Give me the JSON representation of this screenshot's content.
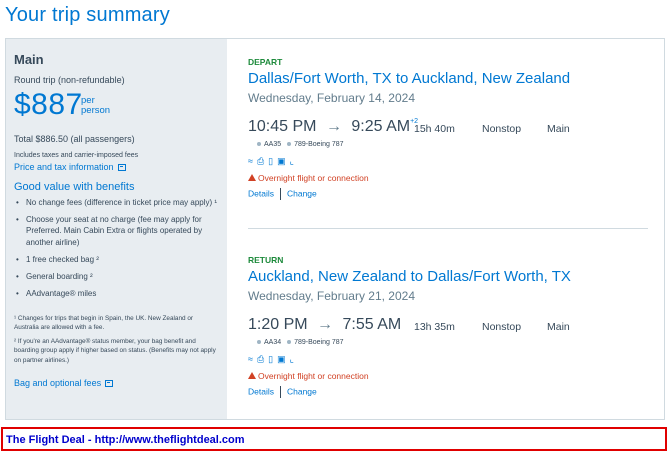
{
  "page_title": "Your trip summary",
  "fare": {
    "name": "Main",
    "type": "Round trip (non-refundable)",
    "price": "$887",
    "per_line1": "per",
    "per_line2": "person",
    "total": "Total $886.50 (all passengers)",
    "includes": "Includes taxes and carrier-imposed fees",
    "tax_link": "Price and tax information"
  },
  "benefits": {
    "heading": "Good value with benefits",
    "items": [
      "No change fees (difference in ticket price may apply) ¹",
      "Choose your seat at no charge (fee may apply for Preferred. Main Cabin Extra or flights operated by another airline)",
      "1 free checked bag ²",
      "General boarding ²",
      "AAdvantage® miles"
    ],
    "footnote1": "¹ Changes for trips that begin in Spain, the UK. New Zealand or Australia are allowed with a fee.",
    "footnote2": "² If you're an AAdvantage® status member, your bag benefit and boarding group apply if higher based on status. (Benefits may not apply on partner airlines.)",
    "bag_link": "Bag and optional fees"
  },
  "segments": [
    {
      "label": "DEPART",
      "route": "Dallas/Fort Worth, TX to Auckland, New Zealand",
      "date": "Wednesday, February 14, 2024",
      "depart_time": "10:45 PM",
      "arrow": "→",
      "arrive_time": "9:25 AM",
      "day_offset": "+2",
      "duration": "15h 40m",
      "stops": "Nonstop",
      "cabin": "Main",
      "flight": "AA35",
      "aircraft": "789-Boeing 787",
      "overnight": "Overnight flight or connection",
      "details": "Details",
      "change": "Change"
    },
    {
      "label": "RETURN",
      "route": "Auckland, New Zealand to Dallas/Fort Worth, TX",
      "date": "Wednesday, February 21, 2024",
      "depart_time": "1:20 PM",
      "arrow": "→",
      "arrive_time": "7:55 AM",
      "day_offset": "",
      "duration": "13h 35m",
      "stops": "Nonstop",
      "cabin": "Main",
      "flight": "AA34",
      "aircraft": "789-Boeing 787",
      "overnight": "Overnight flight or connection",
      "details": "Details",
      "change": "Change"
    }
  ],
  "amenity_icons": [
    "wifi-icon",
    "power-icon",
    "usb-icon",
    "entertainment-icon",
    "lie-flat-seat-icon"
  ],
  "footer": "The Flight Deal - http://www.theflightdeal.com",
  "colors": {
    "accent": "#0078d2",
    "depart_label": "#1d8a3b",
    "warning": "#d14124",
    "panel_bg": "#e8edf1",
    "footer_border": "#e00000"
  }
}
